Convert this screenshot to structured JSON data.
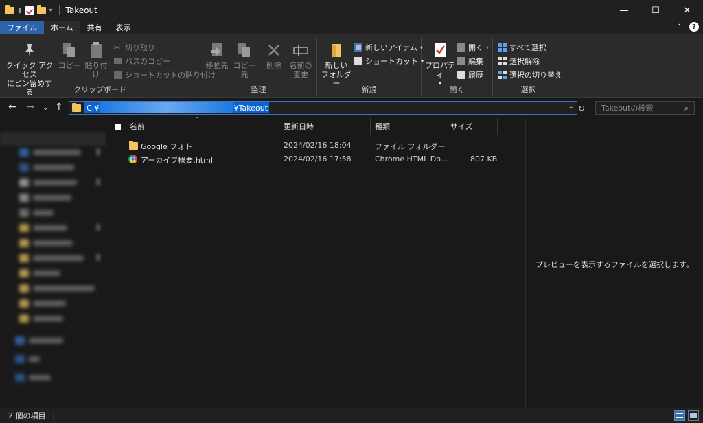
{
  "window": {
    "title": "Takeout",
    "minimize": "—",
    "maximize": "☐",
    "close": "✕"
  },
  "tabs": {
    "file": "ファイル",
    "home": "ホーム",
    "share": "共有",
    "view": "表示"
  },
  "ribbon": {
    "clipboard": {
      "label": "クリップボード",
      "pin_line1": "クイック アクセス",
      "pin_line2": "にピン留めする",
      "copy": "コピー",
      "paste": "貼り付け",
      "cut": "切り取り",
      "copy_path": "パスのコピー",
      "paste_shortcut": "ショートカットの貼り付け"
    },
    "organize": {
      "label": "整理",
      "move_to": "移動先",
      "copy_to": "コピー先",
      "delete": "削除",
      "rename_line1": "名前の",
      "rename_line2": "変更"
    },
    "new": {
      "label": "新規",
      "new_folder_line1": "新しい",
      "new_folder_line2": "フォルダー",
      "new_item": "新しいアイテム",
      "shortcut": "ショートカット"
    },
    "open": {
      "label": "開く",
      "properties": "プロパティ",
      "open": "開く",
      "edit": "編集",
      "history": "履歴"
    },
    "select": {
      "label": "選択",
      "select_all": "すべて選択",
      "select_none": "選択解除",
      "invert": "選択の切り替え"
    }
  },
  "address": {
    "prefix": "C:¥",
    "suffix": "¥Takeout",
    "search_placeholder": "Takeoutの検索"
  },
  "columns": {
    "name": "名前",
    "modified": "更新日時",
    "type": "種類",
    "size": "サイズ"
  },
  "files": [
    {
      "name": "Google フォト",
      "modified": "2024/02/16 18:04",
      "type": "ファイル フォルダー",
      "size": "",
      "icon": "folder-icon"
    },
    {
      "name": "アーカイブ概要.html",
      "modified": "2024/02/16 17:58",
      "type": "Chrome HTML Do...",
      "size": "807 KB",
      "icon": "chrome-icon"
    }
  ],
  "preview": {
    "message": "プレビューを表示するファイルを選択します。"
  },
  "status": {
    "count": "2 個の項目",
    "sep": "|"
  },
  "colors": {
    "accent": "#2d63a8",
    "selection": "#0b63d0",
    "folder": "#f2c55c",
    "background": "#191919"
  }
}
